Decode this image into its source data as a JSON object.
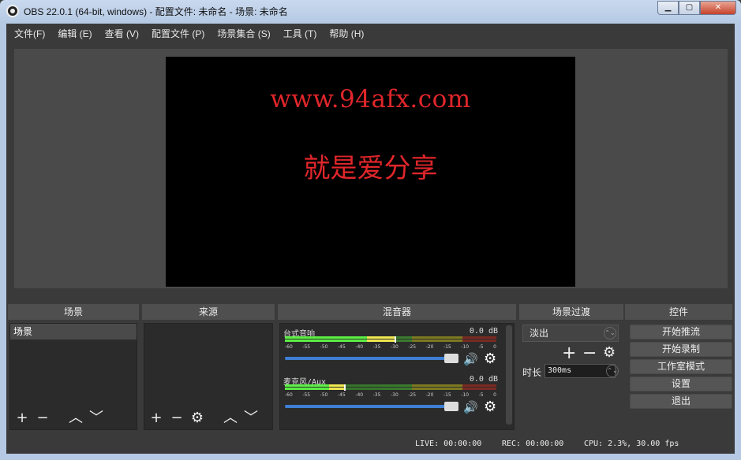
{
  "window": {
    "title": "OBS 22.0.1 (64-bit, windows) - 配置文件: 未命名 - 场景: 未命名",
    "min_glyph": "▁",
    "max_glyph": "▢",
    "close_glyph": "✕"
  },
  "menu": [
    {
      "label": "文件(F)"
    },
    {
      "label": "编辑 (E)"
    },
    {
      "label": "查看 (V)"
    },
    {
      "label": "配置文件 (P)"
    },
    {
      "label": "场景集合 (S)"
    },
    {
      "label": "工具 (T)"
    },
    {
      "label": "帮助 (H)"
    }
  ],
  "preview": {
    "url_text": "www.94afx.com",
    "slogan_text": "就是爱分享",
    "text_color": "#e0262b"
  },
  "docks": {
    "scenes": {
      "title": "场景",
      "items": [
        "场景"
      ]
    },
    "sources": {
      "title": "来源"
    },
    "mixer": {
      "title": "混音器",
      "scale": [
        "-60",
        "-55",
        "-50",
        "-45",
        "-40",
        "-35",
        "-30",
        "-25",
        "-20",
        "-15",
        "-10",
        "-5",
        "0"
      ],
      "channels": [
        {
          "name": "台式音响",
          "db": "0.0 dB",
          "level": 0.52,
          "volume": 1.0
        },
        {
          "name": "麦克风/Aux",
          "db": "0.0 dB",
          "level": 0.28,
          "volume": 1.0
        }
      ]
    },
    "transitions": {
      "title": "场景过渡",
      "selected": "淡出",
      "duration_label": "时长",
      "duration_value": "300ms"
    },
    "controls": {
      "title": "控件",
      "buttons": [
        "开始推流",
        "开始录制",
        "工作室模式",
        "设置",
        "退出"
      ]
    }
  },
  "icons": {
    "plus": "+",
    "minus": "−",
    "up": "︿",
    "down": "﹀",
    "gear": "⚙",
    "speaker": "🔊"
  },
  "status": {
    "live": "LIVE: 00:00:00",
    "rec": "REC: 00:00:00",
    "cpu": "CPU: 2.3%, 30.00 fps"
  }
}
